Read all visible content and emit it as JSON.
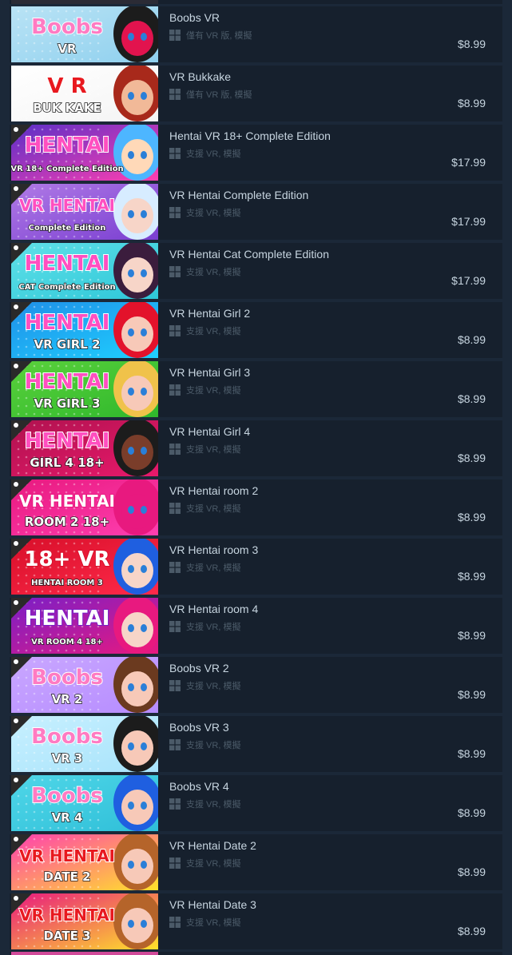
{
  "items": [
    {
      "title": "Boobs VR",
      "tags": "僅有 VR 版, 模擬",
      "price": "$8.99",
      "cap": {
        "bg1": "#b9e3f5",
        "bg2": "#8fd0ee",
        "text": "Boobs",
        "text2": "VR",
        "fill": "#ff7bc2",
        "stroke": "#ffffff",
        "char": "#e2134e",
        "hair": "#1c1c1c"
      }
    },
    {
      "title": "VR Bukkake",
      "tags": "僅有 VR 版, 模擬",
      "price": "$8.99",
      "cap": {
        "bg1": "#ffffff",
        "bg2": "#f4f4f4",
        "text": "V   R",
        "text2": "BUK  KAKE",
        "fill": "#e8191f",
        "stroke": "#ffffff",
        "char": "#f1b998",
        "hair": "#a8291b"
      }
    },
    {
      "title": "Hentai VR 18+ Complete Edition",
      "tags": "支援 VR, 模擬",
      "price": "$17.99",
      "cap": {
        "bg1": "#5a2fc7",
        "bg2": "#ff3fb0",
        "text": "HENTAI",
        "text2": "VR 18+ Complete Edition",
        "fill": "#ff4fc0",
        "stroke": "#ffffff",
        "char": "#ffd9b8",
        "hair": "#4db6ff"
      }
    },
    {
      "title": "VR Hentai Complete Edition",
      "tags": "支援 VR, 模擬",
      "price": "$17.99",
      "cap": {
        "bg1": "#b07ae6",
        "bg2": "#7a3fd1",
        "text": "VR HENTAI",
        "text2": "Complete Edition",
        "fill": "#ff4fc0",
        "stroke": "#ffffff",
        "char": "#f7d5c8",
        "hair": "#d7ecff"
      }
    },
    {
      "title": "VR Hentai Cat Complete Edition",
      "tags": "支援 VR, 模擬",
      "price": "$17.99",
      "cap": {
        "bg1": "#5fe0e8",
        "bg2": "#2ec7d8",
        "text": "HENTAI",
        "text2": "CAT Complete Edition",
        "fill": "#ff4fc0",
        "stroke": "#ffffff",
        "char": "#f7d5c8",
        "hair": "#3b1d3d"
      }
    },
    {
      "title": "VR Hentai Girl 2",
      "tags": "支援 VR, 模擬",
      "price": "$8.99",
      "cap": {
        "bg1": "#1f8fe8",
        "bg2": "#1fd0ff",
        "text": "HENTAI",
        "text2": "VR GIRL 2",
        "fill": "#ff4fc0",
        "stroke": "#ffffff",
        "char": "#f7c9b8",
        "hair": "#e3122b"
      }
    },
    {
      "title": "VR Hentai Girl 3",
      "tags": "支援 VR, 模擬",
      "price": "$8.99",
      "cap": {
        "bg1": "#5ad13c",
        "bg2": "#2fb82c",
        "text": "HENTAI",
        "text2": "VR GIRL 3",
        "fill": "#ff4fc0",
        "stroke": "#ffffff",
        "char": "#f7c9b8",
        "hair": "#f0c24a"
      }
    },
    {
      "title": "VR Hentai Girl 4",
      "tags": "支援 VR, 模擬",
      "price": "$8.99",
      "cap": {
        "bg1": "#b0124f",
        "bg2": "#e8196b",
        "text": "HENTAI",
        "text2": "GIRL 4 18+",
        "fill": "#ff4fc0",
        "stroke": "#ffffff",
        "char": "#7a3d2a",
        "hair": "#1c1c1c"
      }
    },
    {
      "title": "VR Hentai room 2",
      "tags": "支援 VR, 模擬",
      "price": "$8.99",
      "cap": {
        "bg1": "#e8197f",
        "bg2": "#ff3fb0",
        "text": "VR HENTAI",
        "text2": "ROOM 2 18+",
        "fill": "#ffffff",
        "stroke": "#e8197f",
        "char": "#e8197f",
        "hair": "#e8197f"
      }
    },
    {
      "title": "VR Hentai room 3",
      "tags": "支援 VR, 模擬",
      "price": "$8.99",
      "cap": {
        "bg1": "#d80f2a",
        "bg2": "#ff2a4a",
        "text": "18+ VR",
        "text2": "HENTAI ROOM 3",
        "fill": "#ffffff",
        "stroke": "#d80f2a",
        "char": "#f7d5c8",
        "hair": "#1f5fe0"
      }
    },
    {
      "title": "VR Hentai room 4",
      "tags": "支援 VR, 模擬",
      "price": "$8.99",
      "cap": {
        "bg1": "#7a1fc7",
        "bg2": "#e8197f",
        "text": "HENTAI",
        "text2": "VR ROOM 4 18+",
        "fill": "#ffffff",
        "stroke": "#7a1fc7",
        "char": "#f7d5c8",
        "hair": "#e8197f"
      }
    },
    {
      "title": "Boobs VR 2",
      "tags": "支援 VR, 模擬",
      "price": "$8.99",
      "cap": {
        "bg1": "#c9a7ff",
        "bg2": "#b68cff",
        "text": "Boobs",
        "text2": "VR 2",
        "fill": "#ff7bc2",
        "stroke": "#ffffff",
        "char": "#f7c9b8",
        "hair": "#6b3a1f"
      }
    },
    {
      "title": "Boobs VR 3",
      "tags": "支援 VR, 模擬",
      "price": "$8.99",
      "cap": {
        "bg1": "#c7f0ff",
        "bg2": "#a8e3fb",
        "text": "Boobs",
        "text2": "VR 3",
        "fill": "#ff7bc2",
        "stroke": "#ffffff",
        "char": "#f7c9b8",
        "hair": "#1c1c1c"
      }
    },
    {
      "title": "Boobs VR 4",
      "tags": "支援 VR, 模擬",
      "price": "$8.99",
      "cap": {
        "bg1": "#4fd6e8",
        "bg2": "#2fbfd8",
        "text": "Boobs",
        "text2": "VR 4",
        "fill": "#ff7bc2",
        "stroke": "#ffffff",
        "char": "#f7c9b8",
        "hair": "#1f5fe0"
      }
    },
    {
      "title": "VR Hentai Date 2",
      "tags": "支援 VR, 模擬",
      "price": "$8.99",
      "cap": {
        "bg1": "#ff3fb0",
        "bg2": "#ffe22a",
        "text": "VR HENTAI",
        "text2": "DATE 2",
        "fill": "#e8191f",
        "stroke": "#ffffff",
        "char": "#f7c9b8",
        "hair": "#b5642a"
      }
    },
    {
      "title": "VR Hentai Date 3",
      "tags": "支援 VR, 模擬",
      "price": "$8.99",
      "cap": {
        "bg1": "#e8197f",
        "bg2": "#ffe22a",
        "text": "VR HENTAI",
        "text2": "DATE 3",
        "fill": "#e8191f",
        "stroke": "#ffffff",
        "char": "#f7c9b8",
        "hair": "#b5642a"
      }
    }
  ],
  "colors": {
    "page_bg": "#1b2838",
    "row_bg": "#16202d",
    "title": "#c7d5e0",
    "tags": "#4b5a68",
    "price": "#c7d5e0"
  },
  "icons": {
    "platform": "windows-icon",
    "dlc": "download-dlc-icon"
  }
}
